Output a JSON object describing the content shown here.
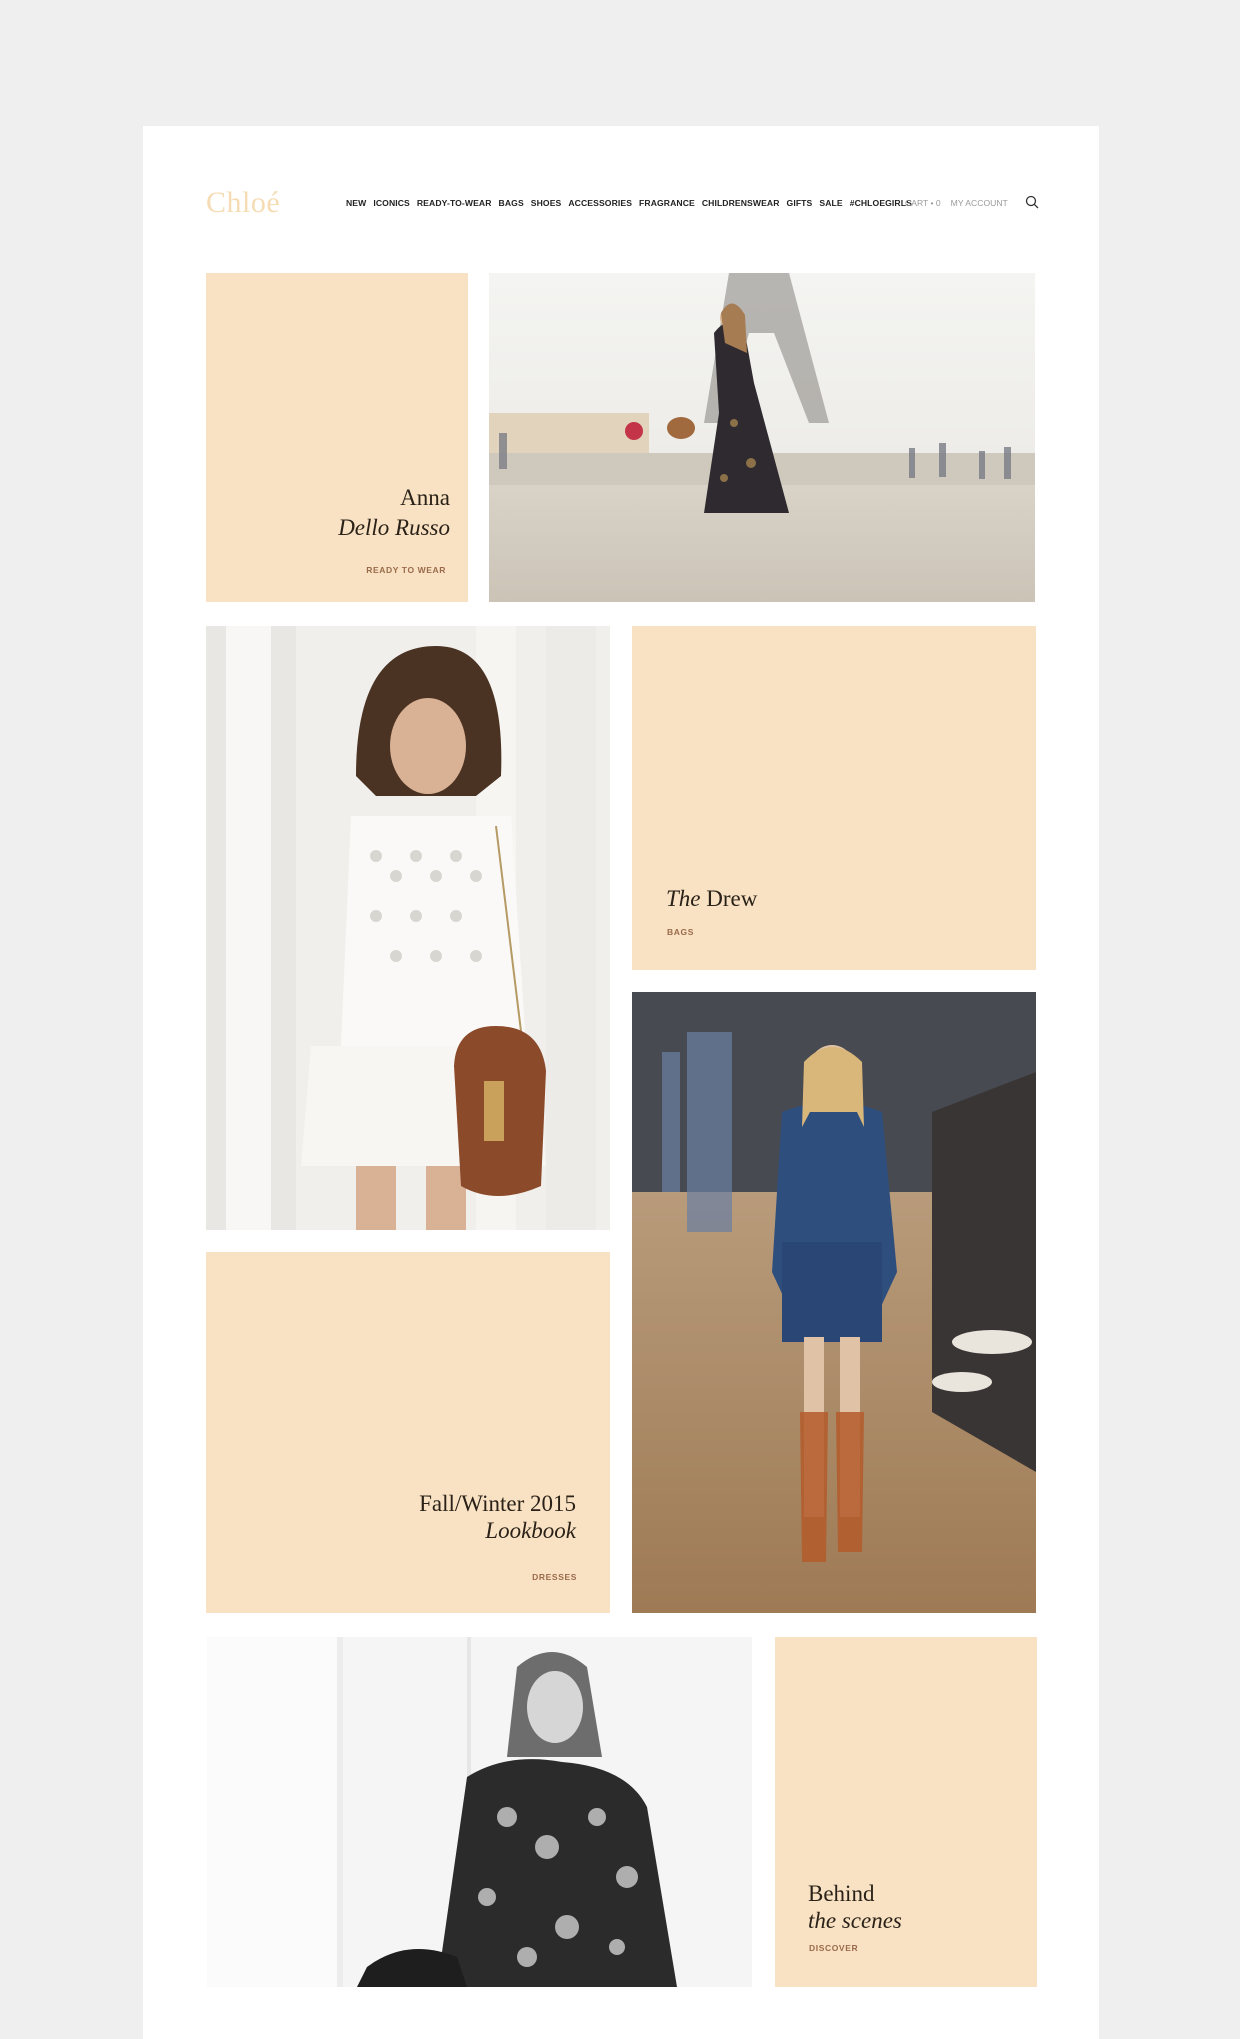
{
  "brand": {
    "logo": "Chloé"
  },
  "nav": {
    "items": [
      "NEW",
      "ICONICS",
      "READY-TO-WEAR",
      "BAGS",
      "SHOES",
      "ACCESSORIES",
      "FRAGRANCE",
      "CHILDRENSWEAR",
      "GIFTS",
      "SALE",
      "#CHLOEGIRLS"
    ]
  },
  "account": {
    "cart": "CART • 0",
    "my_account": "MY ACCOUNT"
  },
  "tiles": {
    "anna": {
      "line1": "Anna",
      "line2": "Dello Russo",
      "caption": "READY TO WEAR"
    },
    "drew": {
      "italic": "The",
      "rest": "Drew",
      "caption": "BAGS"
    },
    "fw": {
      "line1": "Fall/Winter 2015",
      "line2": "Lookbook",
      "caption": "DRESSES"
    },
    "behind": {
      "line1": "Behind",
      "line2": "the scenes",
      "caption": "DISCOVER"
    }
  },
  "colors": {
    "beige": "#f8e2c3",
    "logo": "#f6dcb4",
    "caption": "#9a6a4a"
  }
}
